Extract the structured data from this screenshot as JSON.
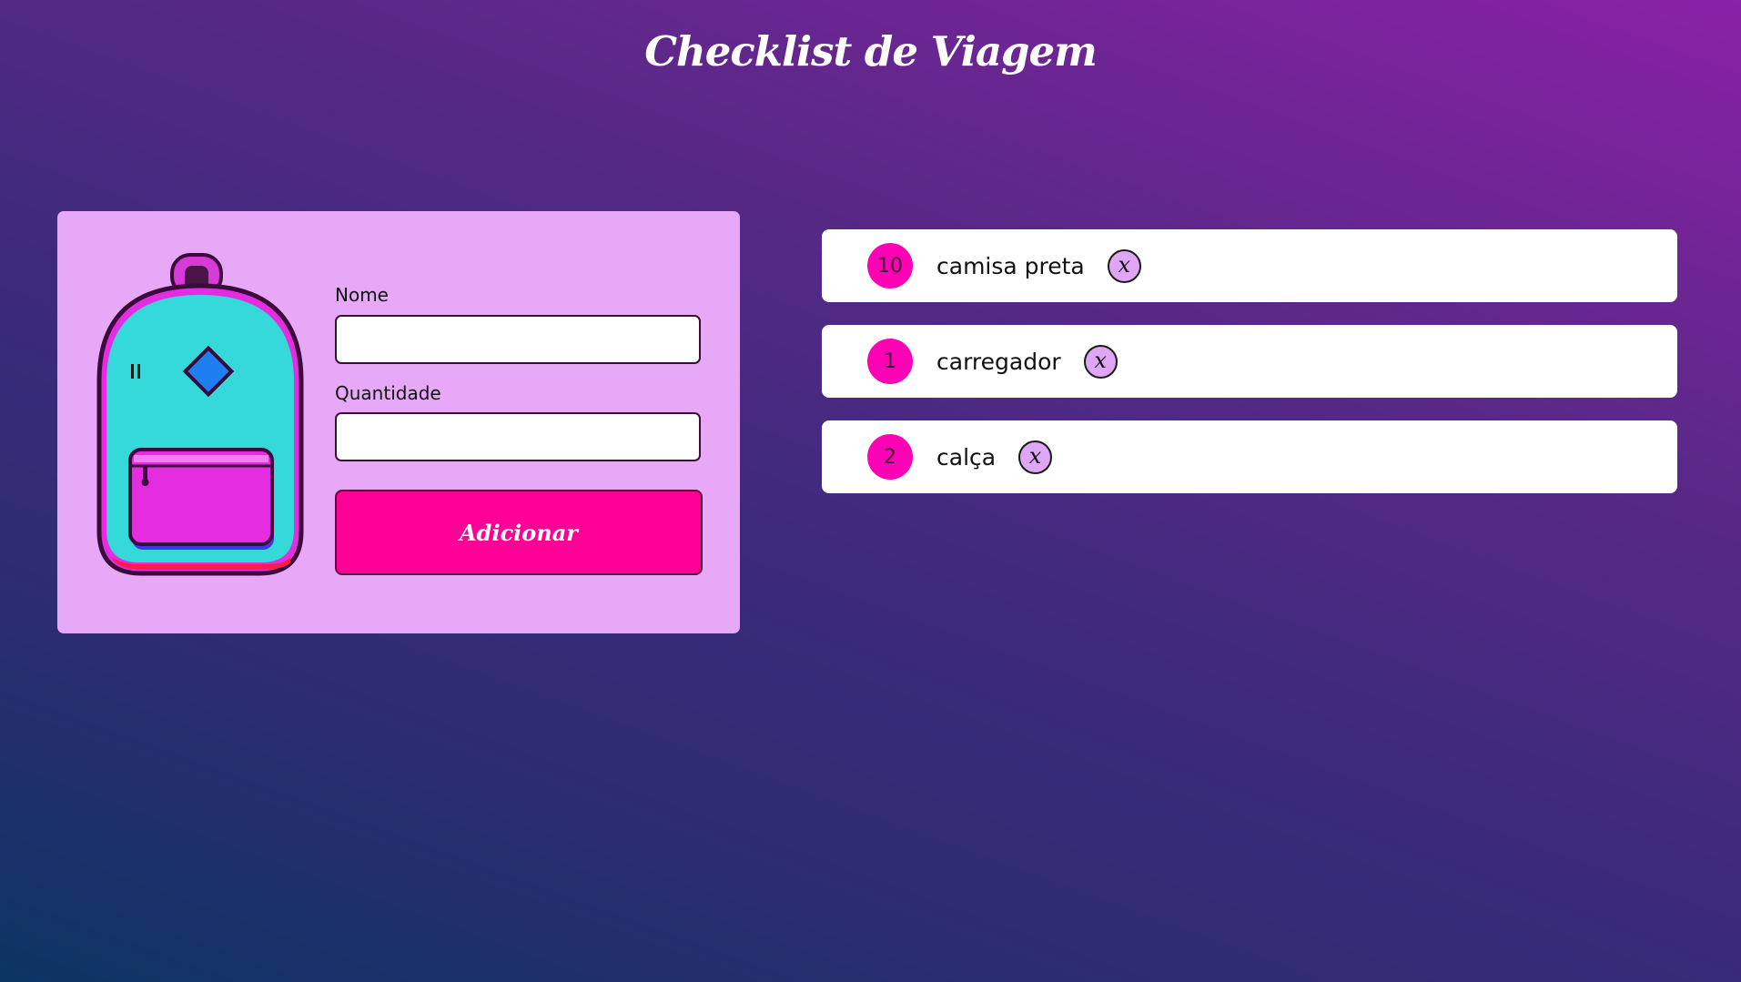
{
  "header": {
    "title": "Checklist de Viagem"
  },
  "form": {
    "name_label": "Nome",
    "name_value": "",
    "quantity_label": "Quantidade",
    "quantity_value": "",
    "add_label": "Adicionar"
  },
  "items": [
    {
      "quantity": "10",
      "name": "camisa preta",
      "delete_glyph": "x"
    },
    {
      "quantity": "1",
      "name": "carregador",
      "delete_glyph": "x"
    },
    {
      "quantity": "2",
      "name": "calça",
      "delete_glyph": "x"
    }
  ],
  "colors": {
    "card_background": "#e8a8f8",
    "accent_pink": "#ff0096",
    "badge_pink": "#ff00b4",
    "delete_button": "#dea6f4",
    "backpack_body": "#36d9d9",
    "backpack_pocket": "#e42de0"
  },
  "icons": {
    "backpack": "backpack-illustration",
    "delete": "close-icon"
  }
}
